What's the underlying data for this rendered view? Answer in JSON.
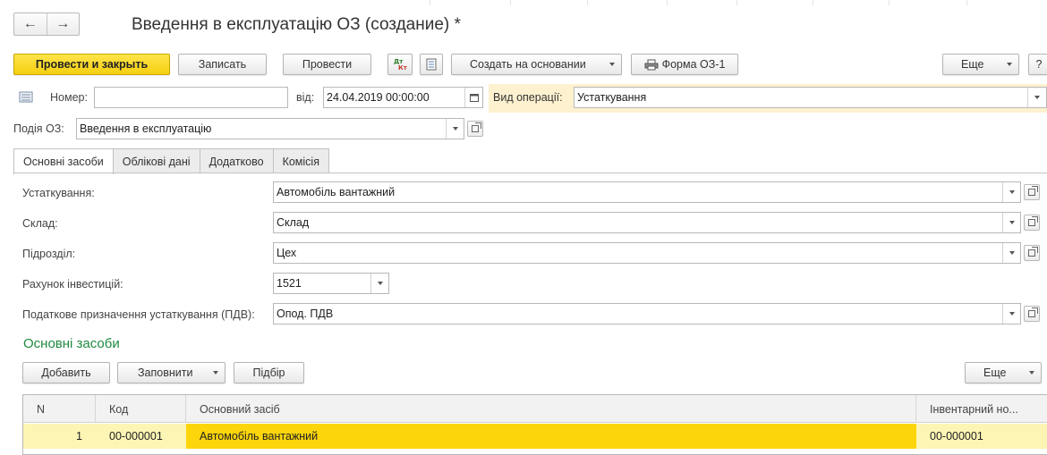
{
  "window": {
    "title": "Введення в експлуатацію ОЗ (создание) *"
  },
  "nav": {
    "back_icon": "←",
    "forward_icon": "→"
  },
  "toolbar": {
    "post_close": "Провести и закрыть",
    "save": "Записать",
    "post": "Провести",
    "create_based": "Создать на основании",
    "print_form": "Форма ОЗ-1",
    "more": "Еще",
    "help": "?"
  },
  "header": {
    "number_label": "Номер:",
    "number_value": "",
    "date_label": "від:",
    "date_value": "24.04.2019 00:00:00",
    "operation_label": "Вид операції:",
    "operation_value": "Устаткування",
    "event_label": "Подія ОЗ:",
    "event_value": "Введення в експлуатацію"
  },
  "tabs": [
    "Основні засоби",
    "Облікові дані",
    "Додатково",
    "Комісія"
  ],
  "form": {
    "equipment_label": "Устаткування:",
    "equipment_value": "Автомобіль вантажний",
    "warehouse_label": "Склад:",
    "warehouse_value": "Склад",
    "department_label": "Підрозділ:",
    "department_value": "Цех",
    "invest_label": "Рахунок інвестицій:",
    "invest_value": "1521",
    "tax_label": "Податкове призначення устаткування (ПДВ):",
    "tax_value": "Опод. ПДВ"
  },
  "section": {
    "title": "Основні засоби",
    "add": "Добавить",
    "fill": "Заповнити",
    "pick": "Підбір",
    "more": "Еще"
  },
  "table": {
    "columns": [
      "N",
      "Код",
      "Основний засіб",
      "Інвентарний но..."
    ],
    "rows": [
      {
        "n": "1",
        "code": "00-000001",
        "asset": "Автомобіль вантажний",
        "inv": "00-000001"
      }
    ]
  },
  "colors": {
    "accent": "#f5cf10",
    "section_title": "#1f8a3f",
    "row_highlight": "#fdf5b4",
    "cell_selected": "#fcd50b"
  }
}
